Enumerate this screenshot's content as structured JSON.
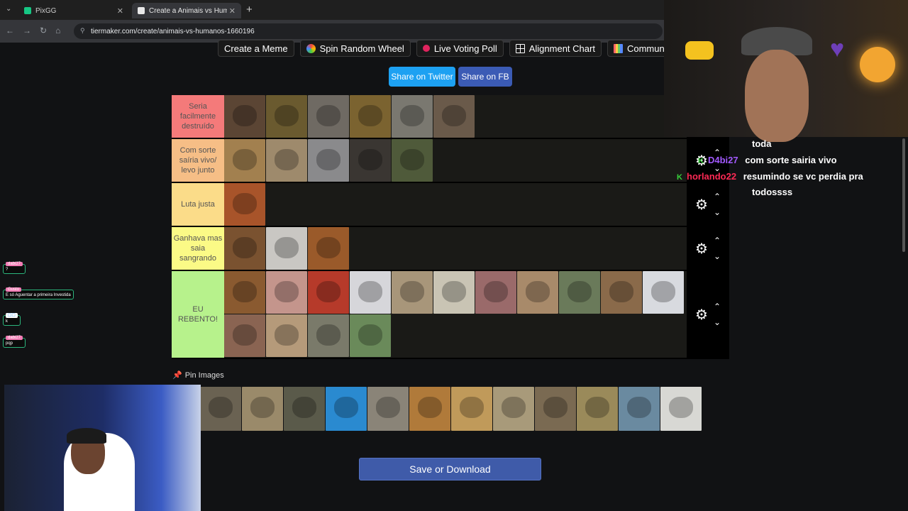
{
  "browser": {
    "tabs": [
      {
        "label": "PixGG",
        "close": "✕"
      },
      {
        "label": "Create a Animais vs Humanos T",
        "close": "✕"
      }
    ],
    "menu_glyph": "⌄",
    "new_tab": "+",
    "url": "tiermaker.com/create/animais-vs-humanos-1660196"
  },
  "topnav": [
    "Create a Meme",
    "Spin Random Wheel",
    "Live Voting Poll",
    "Alignment Chart",
    "Community R"
  ],
  "share": {
    "twitter": "Share on Twitter",
    "fb": "Share on FB"
  },
  "tiers": [
    {
      "label": "Seria facilmente destruído",
      "color": "#f47a7a",
      "tiles": [
        "#5b4534",
        "#6a5a2f",
        "#6f6a63",
        "#7b6330",
        "#7a7870",
        "#6a5a4a"
      ]
    },
    {
      "label": "Com sorte saíria vivo/ levo junto",
      "color": "#f6be86",
      "tiles": [
        "#a2804f",
        "#9e8a6c",
        "#8a8a8c",
        "#3a3632",
        "#4f5a3a"
      ]
    },
    {
      "label": "Luta justa",
      "color": "#fbdc89",
      "tiles": [
        "#a8542a"
      ]
    },
    {
      "label": "Ganhava mas saia sangrando",
      "color": "#fbfa86",
      "tiles": [
        "#7a5230",
        "#c9c7c3",
        "#9a5a2a"
      ]
    },
    {
      "label": "EU REBENTO!",
      "color": "#b7f28c",
      "tiles": [
        "#8a5a30",
        "#c4958c",
        "#b63a2a",
        "#d6d6da",
        "#a8967a",
        "#c9c4b4",
        "#9a6a6a",
        "#a88a6a",
        "#6a7a5a",
        "#8a6a4a",
        "#d8dadf",
        "#8a6452",
        "#b59a7a",
        "#7a7a6a",
        "#6a8a5a"
      ]
    }
  ],
  "pin_label": "Pin Images",
  "pool_tiles": [
    "#6a6252",
    "#9a8a6a",
    "#5a5a4a",
    "#2a8ad0",
    "#8a8478",
    "#b07a3a",
    "#c09a5a",
    "#a89a7a",
    "#7a6a52",
    "#9a8a5a",
    "#6a8aa0",
    "#d8d8d4"
  ],
  "save_label": "Save or Download",
  "chat": [
    {
      "user": "",
      "text": "toda"
    },
    {
      "user": "D4bi27",
      "text": "com sorte sairia vivo"
    },
    {
      "user": "horlando22",
      "text": "resumindo se vc perdia pra"
    },
    {
      "user": "",
      "text": "todossss"
    }
  ],
  "overlay_bubbles": [
    {
      "header": "dabi27",
      "text": "?"
    },
    {
      "header": "Gusto",
      "text": "E só Aguentar a primeira Investida"
    },
    {
      "header": "",
      "text": "k"
    },
    {
      "header": "dabi27",
      "text": "pqp"
    }
  ],
  "icons": {
    "gear": "⚙",
    "up": "⌃",
    "down": "⌄",
    "pin": "📌"
  }
}
